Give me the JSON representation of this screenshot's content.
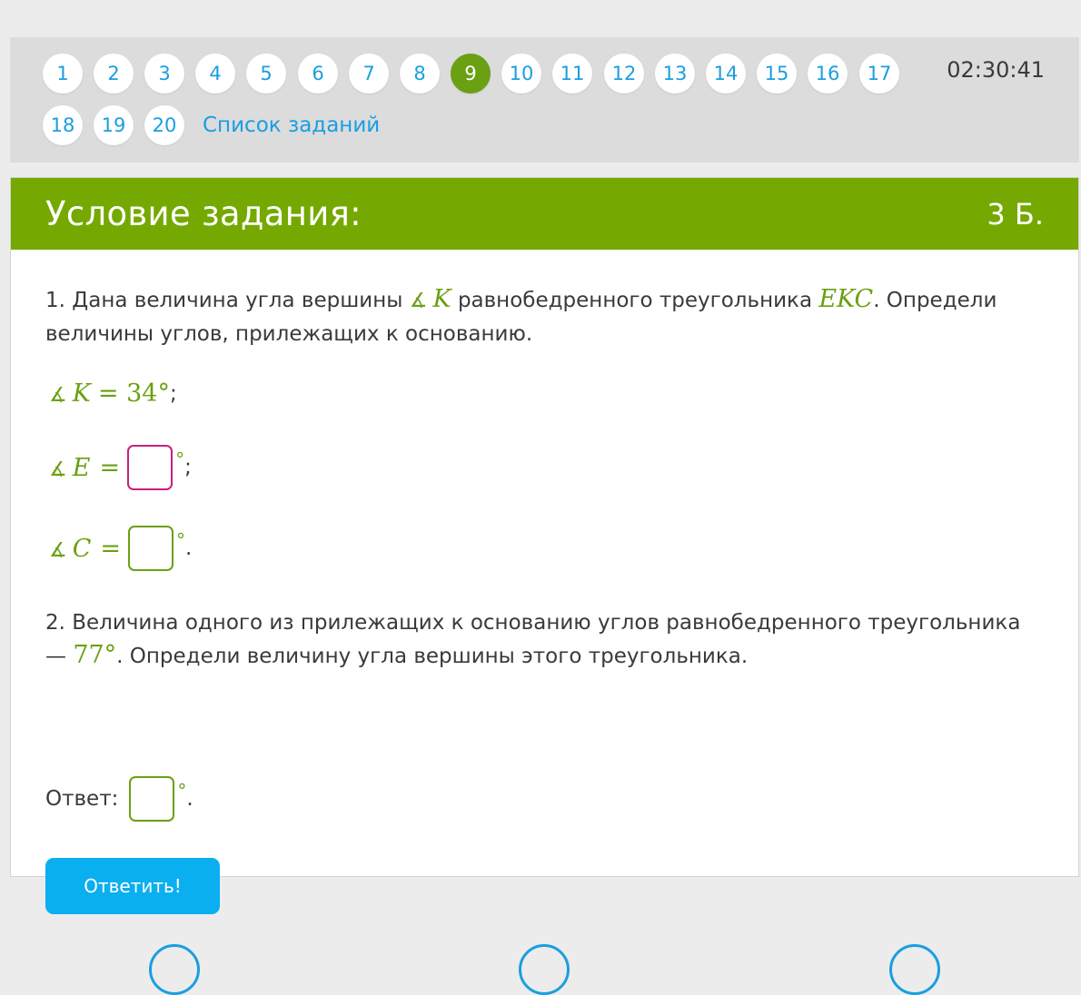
{
  "nav": {
    "row1": [
      "1",
      "2",
      "3",
      "4",
      "5",
      "6",
      "7",
      "8",
      "9",
      "10",
      "11",
      "12",
      "13",
      "14",
      "15",
      "16",
      "17"
    ],
    "row2": [
      "18",
      "19",
      "20"
    ],
    "active": "9",
    "task_list_label": "Список заданий",
    "timer": "02:30:41"
  },
  "card": {
    "title": "Условие задания:",
    "points": "3 Б."
  },
  "q1": {
    "text_a": "1. Дана величина угла вершины",
    "angle_symbol": "∡",
    "vertex": "K",
    "text_b": "равнобедренного треугольника",
    "triangle": "EKC",
    "text_c": ". Определи",
    "text_d": "величины углов, прилежащих к основанию.",
    "given_label": "K",
    "given_value": "= 34°",
    "given_end": ";",
    "e_label": "E",
    "e_eq": "=",
    "e_end": ";",
    "c_label": "C",
    "c_eq": "=",
    "c_end": "."
  },
  "q2": {
    "text_a": "2. Величина одного из прилежащих к основанию углов равнобедренного треугольника",
    "dash": "—",
    "value": "77°",
    "text_b": ". Определи величину угла вершины этого треугольника.",
    "answer_label": "Ответ:",
    "answer_end": "."
  },
  "degree_symbol": "°",
  "submit_label": "Ответить!",
  "colors": {
    "accent_green": "#75a902",
    "link_blue": "#1a9ee0",
    "button_blue": "#0aaff0",
    "focus_magenta": "#c8207e"
  }
}
